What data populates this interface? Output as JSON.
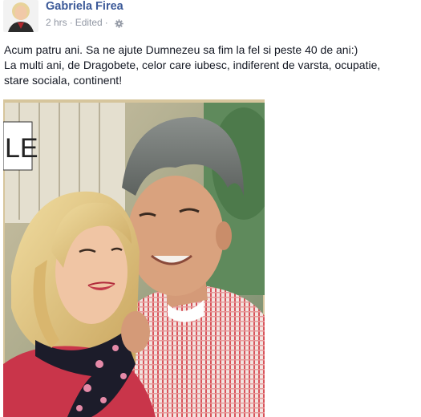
{
  "post": {
    "author": "Gabriela Firea",
    "time": "2 hrs",
    "separator": "·",
    "edited": "Edited",
    "edited_separator": "·",
    "privacy_icon": "gear-icon",
    "message_lines": [
      "Acum patru ani. Sa ne ajute Dumnezeu sa fim la fel si peste 40 de ani:)",
      "La multi ani, de Dragobete, celor care iubesc, indiferent de varsta, ocupatie,",
      "stare sociala, continent!"
    ],
    "photo_sign_text": "LE"
  },
  "colors": {
    "author_link": "#3b5998",
    "meta_text": "#9197a3",
    "body_text": "#141823",
    "photo_border": "#d6c59c",
    "background": "#ffffff"
  }
}
